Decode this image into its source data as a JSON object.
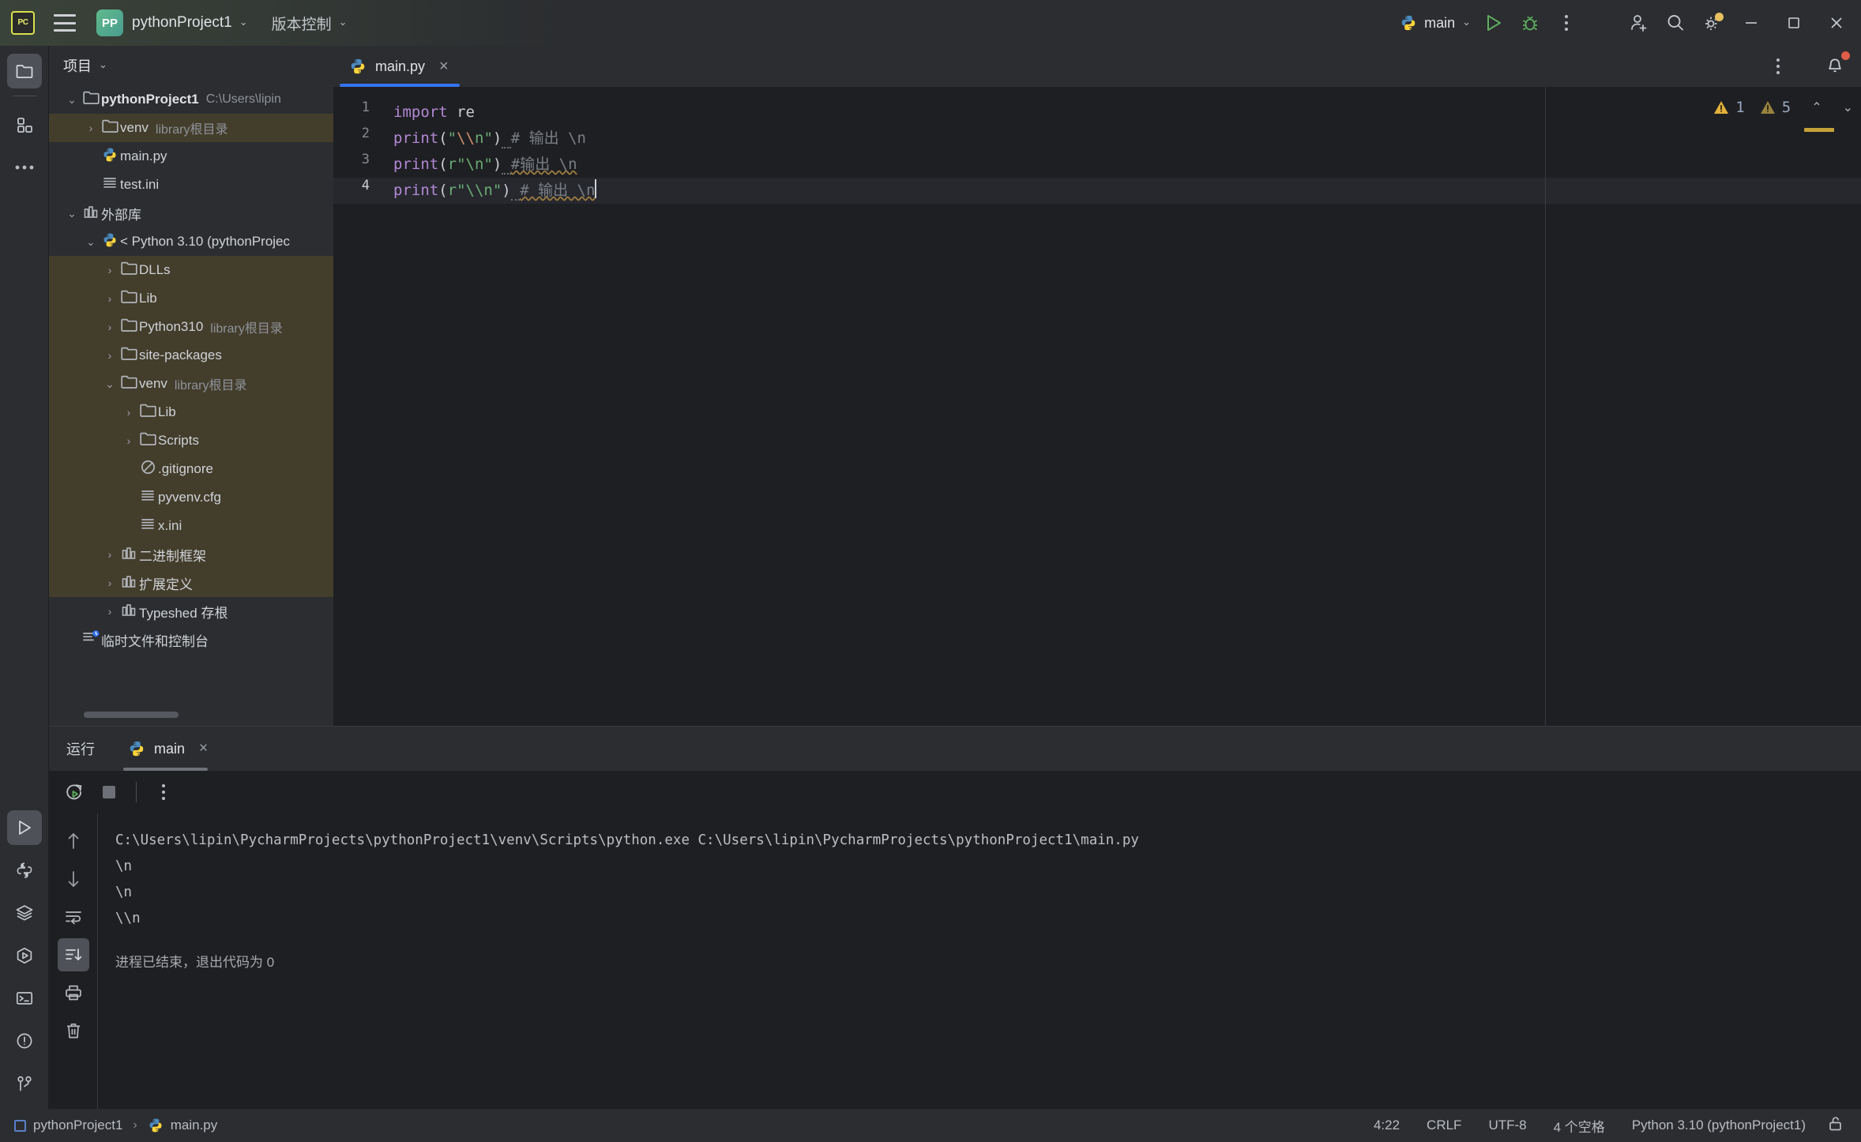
{
  "titlebar": {
    "logo_text": "PC",
    "menu_icon": "hamburger-menu-icon",
    "project_badge": "PP",
    "project_name": "pythonProject1",
    "vcs_label": "版本控制",
    "run_config": "main",
    "icons": {
      "run": "run-icon",
      "debug": "debug-icon",
      "more": "more-options-icon",
      "add_user": "add-user-icon",
      "search": "search-icon",
      "settings": "settings-gear-icon",
      "minimize": "minimize-icon",
      "maximize": "maximize-icon",
      "close": "close-icon"
    }
  },
  "leftrail": {
    "top": [
      {
        "name": "project-tool-window",
        "icon": "folder-icon",
        "active": true
      },
      {
        "name": "structure-tool-window",
        "icon": "squares-icon",
        "active": false
      },
      {
        "name": "more-tool-windows",
        "icon": "ellipsis-icon",
        "active": false
      }
    ],
    "bottom": [
      {
        "name": "run-tool-window",
        "icon": "play-icon",
        "active": true
      },
      {
        "name": "python-console-tool-window",
        "icon": "python-icon",
        "active": false
      },
      {
        "name": "services-tool-window",
        "icon": "layers-icon",
        "active": false
      },
      {
        "name": "python-packages-tool-window",
        "icon": "hexagon-play-icon",
        "active": false
      },
      {
        "name": "terminal-tool-window",
        "icon": "terminal-icon",
        "active": false
      },
      {
        "name": "problems-tool-window",
        "icon": "exclamation-circle-icon",
        "active": false
      },
      {
        "name": "version-control-tool-window",
        "icon": "git-branch-icon",
        "active": false
      }
    ]
  },
  "project": {
    "header_title": "项目",
    "tree": [
      {
        "depth": 0,
        "arrow": "v",
        "icon": "folder",
        "label": "pythonProject1",
        "bold": true,
        "sub": "C:\\Users\\lipin",
        "hl": false
      },
      {
        "depth": 1,
        "arrow": ">",
        "icon": "folder",
        "label": "venv",
        "bold": false,
        "sub": "library根目录",
        "hl": true
      },
      {
        "depth": 1,
        "arrow": "",
        "icon": "python",
        "label": "main.py",
        "bold": false,
        "sub": "",
        "hl": false
      },
      {
        "depth": 1,
        "arrow": "",
        "icon": "ini",
        "label": "test.ini",
        "bold": false,
        "sub": "",
        "hl": false
      },
      {
        "depth": 0,
        "arrow": "v",
        "icon": "lib",
        "label": "外部库",
        "bold": false,
        "sub": "",
        "hl": false
      },
      {
        "depth": 1,
        "arrow": "v",
        "icon": "python",
        "label": "< Python 3.10 (pythonProjec",
        "bold": false,
        "sub": "",
        "hl": false
      },
      {
        "depth": 2,
        "arrow": ">",
        "icon": "folder",
        "label": "DLLs",
        "bold": false,
        "sub": "",
        "hl": true
      },
      {
        "depth": 2,
        "arrow": ">",
        "icon": "folder",
        "label": "Lib",
        "bold": false,
        "sub": "",
        "hl": true
      },
      {
        "depth": 2,
        "arrow": ">",
        "icon": "folder",
        "label": "Python310",
        "bold": false,
        "sub": "library根目录",
        "hl": true
      },
      {
        "depth": 2,
        "arrow": ">",
        "icon": "folder",
        "label": "site-packages",
        "bold": false,
        "sub": "",
        "hl": true
      },
      {
        "depth": 2,
        "arrow": "v",
        "icon": "folder",
        "label": "venv",
        "bold": false,
        "sub": "library根目录",
        "hl": true
      },
      {
        "depth": 3,
        "arrow": ">",
        "icon": "folder",
        "label": "Lib",
        "bold": false,
        "sub": "",
        "hl": true
      },
      {
        "depth": 3,
        "arrow": ">",
        "icon": "folder",
        "label": "Scripts",
        "bold": false,
        "sub": "",
        "hl": true
      },
      {
        "depth": 3,
        "arrow": "",
        "icon": "gitignore",
        "label": ".gitignore",
        "bold": false,
        "sub": "",
        "hl": true
      },
      {
        "depth": 3,
        "arrow": "",
        "icon": "ini",
        "label": "pyvenv.cfg",
        "bold": false,
        "sub": "",
        "hl": true
      },
      {
        "depth": 3,
        "arrow": "",
        "icon": "ini",
        "label": "x.ini",
        "bold": false,
        "sub": "",
        "hl": true
      },
      {
        "depth": 2,
        "arrow": ">",
        "icon": "lib",
        "label": "二进制框架",
        "bold": false,
        "sub": "",
        "hl": true
      },
      {
        "depth": 2,
        "arrow": ">",
        "icon": "lib",
        "label": "扩展定义",
        "bold": false,
        "sub": "",
        "hl": true
      },
      {
        "depth": 2,
        "arrow": ">",
        "icon": "lib",
        "label": "Typeshed 存根",
        "bold": false,
        "sub": "",
        "hl": false
      },
      {
        "depth": 0,
        "arrow": "",
        "icon": "scratch",
        "label": "临时文件和控制台",
        "bold": false,
        "sub": "",
        "hl": false
      }
    ]
  },
  "editor": {
    "tab": {
      "name": "main.py",
      "icon": "python-file-icon",
      "close": "×"
    },
    "tab_more": "editor-options-icon",
    "notification": "notification-bell-icon",
    "inspection": {
      "warning_count": "1",
      "weak_warning_count": "5",
      "up": "⌃",
      "down": "⌄"
    },
    "lines": [
      "1",
      "2",
      "3",
      "4"
    ],
    "current_line": 4,
    "code": [
      {
        "n": 1,
        "tokens": [
          {
            "t": "import ",
            "c": "imp"
          },
          {
            "t": "re",
            "c": "mod"
          }
        ]
      },
      {
        "n": 2,
        "tokens": [
          {
            "t": "print",
            "c": "kw"
          },
          {
            "t": "(",
            "c": "def"
          },
          {
            "t": "\"",
            "c": "str"
          },
          {
            "t": "\\\\",
            "c": "esc"
          },
          {
            "t": "n\"",
            "c": "str"
          },
          {
            "t": ")",
            "c": "def"
          },
          {
            "t": " ",
            "c": "dotted"
          },
          {
            "t": "# 输出 \\n",
            "c": "cmt"
          }
        ]
      },
      {
        "n": 3,
        "tokens": [
          {
            "t": "print",
            "c": "kw"
          },
          {
            "t": "(",
            "c": "def"
          },
          {
            "t": "r\"\\n\"",
            "c": "str"
          },
          {
            "t": ")",
            "c": "def"
          },
          {
            "t": " ",
            "c": "dotted"
          },
          {
            "t": "#输出 \\n",
            "c": "cmt-squig"
          }
        ]
      },
      {
        "n": 4,
        "tokens": [
          {
            "t": "print",
            "c": "kw"
          },
          {
            "t": "(",
            "c": "def"
          },
          {
            "t": "r\"\\\\n\"",
            "c": "str"
          },
          {
            "t": ")",
            "c": "def"
          },
          {
            "t": " ",
            "c": "dotted"
          },
          {
            "t": "# 输出 \\n",
            "c": "cmt-squig"
          }
        ]
      }
    ]
  },
  "runpanel": {
    "title": "运行",
    "tab": {
      "name": "main",
      "icon": "python-icon",
      "close": "×"
    },
    "toolbar": [
      {
        "name": "rerun-button",
        "icon": "rerun-icon"
      },
      {
        "name": "stop-button",
        "icon": "stop-icon"
      },
      {
        "name": "more-run-options-button",
        "icon": "more-options-icon"
      }
    ],
    "console_rail": [
      {
        "name": "previous-occurrence-button",
        "icon": "arrow-up-icon",
        "active": false
      },
      {
        "name": "next-occurrence-button",
        "icon": "arrow-down-icon",
        "active": false
      },
      {
        "name": "soft-wrap-button",
        "icon": "soft-wrap-icon",
        "active": false
      },
      {
        "name": "scroll-to-end-button",
        "icon": "scroll-to-end-icon",
        "active": true
      },
      {
        "name": "print-button",
        "icon": "printer-icon",
        "active": false
      },
      {
        "name": "clear-all-button",
        "icon": "trash-icon",
        "active": false
      }
    ],
    "output": [
      "C:\\Users\\lipin\\PycharmProjects\\pythonProject1\\venv\\Scripts\\python.exe C:\\Users\\lipin\\PycharmProjects\\pythonProject1\\main.py",
      "\\n",
      "\\n",
      "\\\\n"
    ],
    "exit_message": "进程已结束，退出代码为 0"
  },
  "statusbar": {
    "breadcrumb_project": "pythonProject1",
    "breadcrumb_sep": "›",
    "breadcrumb_file": "main.py",
    "caret_position": "4:22",
    "line_separator": "CRLF",
    "encoding": "UTF-8",
    "indent": "4 个空格",
    "interpreter": "Python 3.10 (pythonProject1)",
    "lock_icon": "unlocked-icon"
  },
  "colors": {
    "accent": "#3574f0",
    "warning": "#c6a23a",
    "bg_main": "#1e1f22",
    "bg_panel": "#2b2d30",
    "highlight_lib": "#433d2c"
  }
}
